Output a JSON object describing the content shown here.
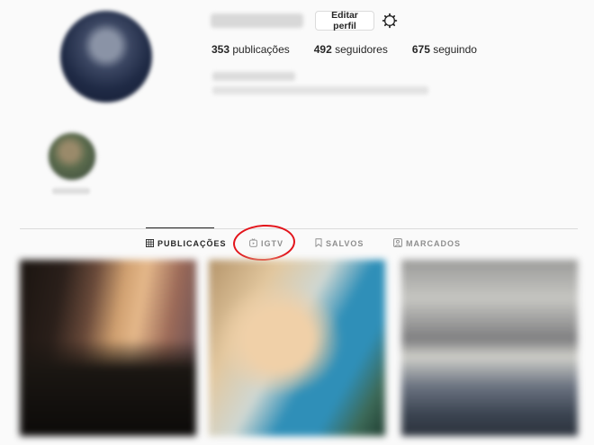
{
  "profile": {
    "edit_label": "Editar perfil",
    "stats": [
      {
        "value": "353",
        "label": "publicações"
      },
      {
        "value": "492",
        "label": "seguidores"
      },
      {
        "value": "675",
        "label": "seguindo"
      }
    ]
  },
  "tabs": [
    {
      "label": "PUBLICAÇÕES",
      "icon": "grid-icon",
      "active": true
    },
    {
      "label": "IGTV",
      "icon": "igtv-icon",
      "active": false
    },
    {
      "label": "SALVOS",
      "icon": "bookmark-icon",
      "active": false
    },
    {
      "label": "MARCADOS",
      "icon": "tagged-icon",
      "active": false
    }
  ],
  "colors": {
    "background": "#fafafa",
    "annotation": "#e3141b",
    "text": "#262626",
    "muted": "#8e8e8e"
  }
}
